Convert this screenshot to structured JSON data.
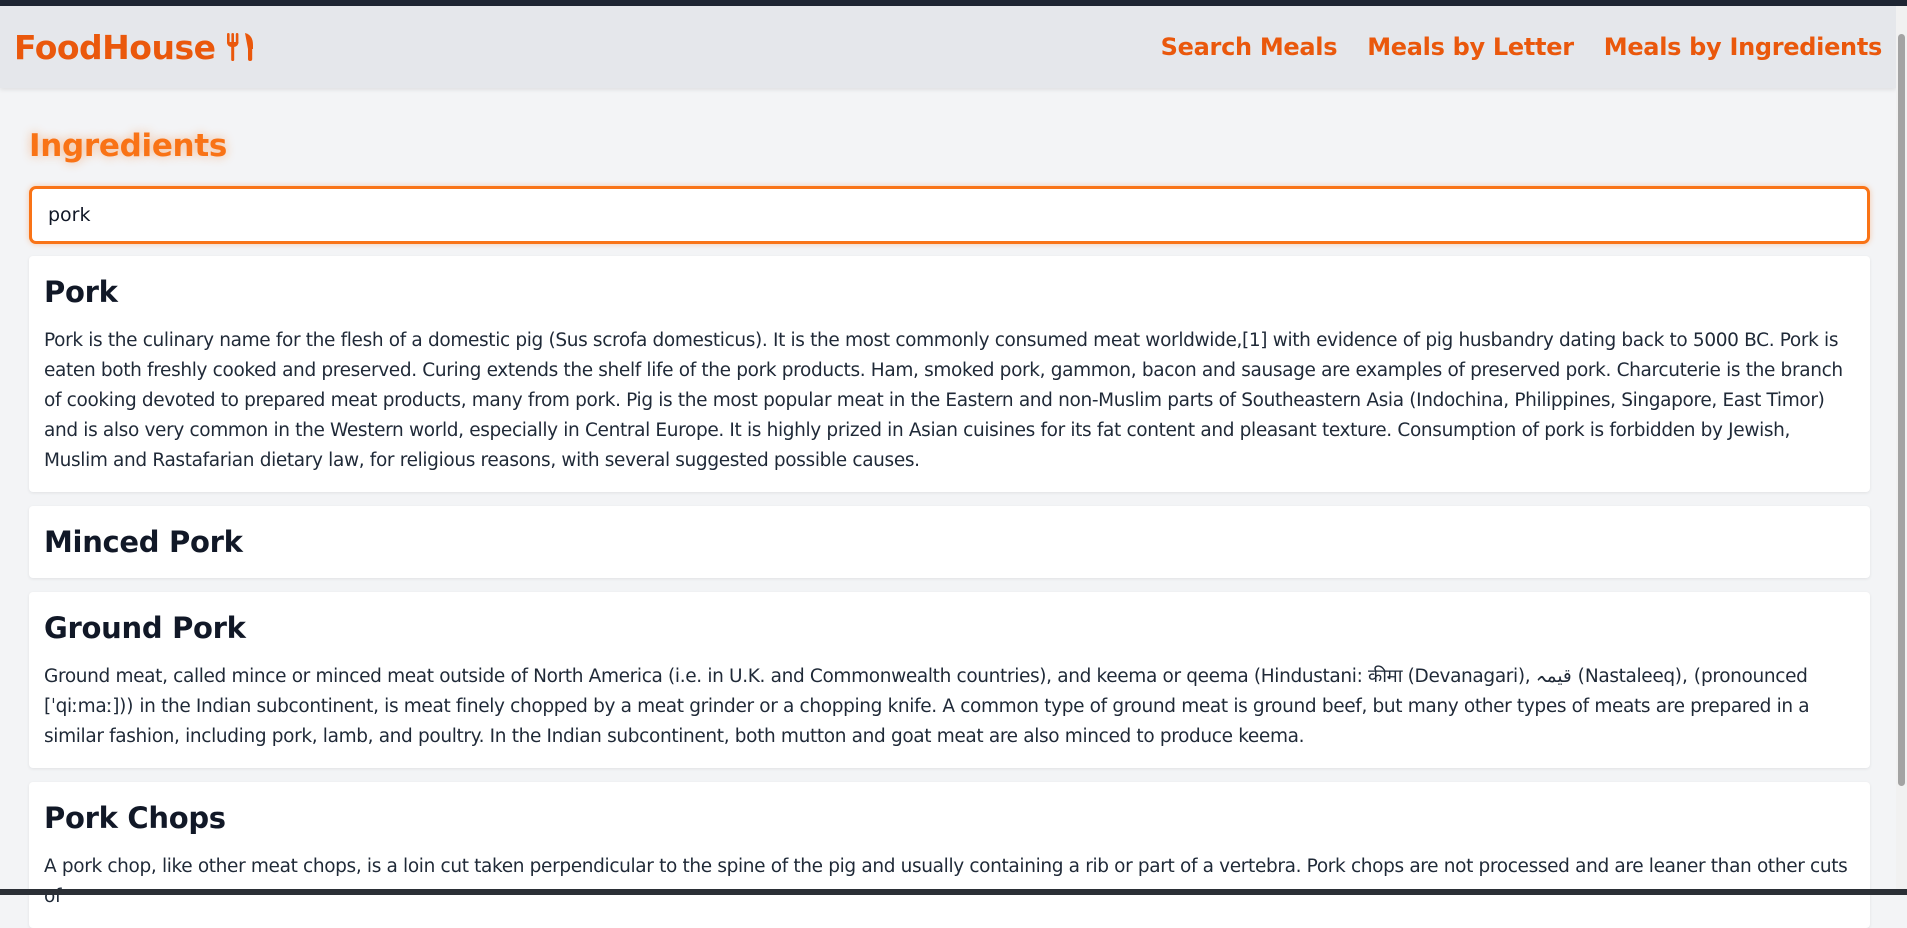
{
  "navbar": {
    "brand": "FoodHouse",
    "brand_icon": "fork-knife-icon",
    "links": [
      "Search Meals",
      "Meals by Letter",
      "Meals by Ingredients"
    ]
  },
  "page": {
    "title": "Ingredients"
  },
  "search": {
    "value": "pork",
    "placeholder": ""
  },
  "ingredients": [
    {
      "name": "Pork",
      "description": "Pork is the culinary name for the flesh of a domestic pig (Sus scrofa domesticus). It is the most commonly consumed meat worldwide,[1] with evidence of pig husbandry dating back to 5000 BC. Pork is eaten both freshly cooked and preserved. Curing extends the shelf life of the pork products. Ham, smoked pork, gammon, bacon and sausage are examples of preserved pork. Charcuterie is the branch of cooking devoted to prepared meat products, many from pork. Pig is the most popular meat in the Eastern and non-Muslim parts of Southeastern Asia (Indochina, Philippines, Singapore, East Timor) and is also very common in the Western world, especially in Central Europe. It is highly prized in Asian cuisines for its fat content and pleasant texture. Consumption of pork is forbidden by Jewish, Muslim and Rastafarian dietary law, for religious reasons, with several suggested possible causes."
    },
    {
      "name": "Minced Pork",
      "description": ""
    },
    {
      "name": "Ground Pork",
      "description": "Ground meat, called mince or minced meat outside of North America (i.e. in U.K. and Commonwealth countries), and keema or qeema (Hindustani: कीमा (Devanagari), قیمہ (Nastaleeq), (pronounced [ˈqiːmaː])) in the Indian subcontinent, is meat finely chopped by a meat grinder or a chopping knife. A common type of ground meat is ground beef, but many other types of meats are prepared in a similar fashion, including pork, lamb, and poultry. In the Indian subcontinent, both mutton and goat meat are also minced to produce keema."
    },
    {
      "name": "Pork Chops",
      "description": "A pork chop, like other meat chops, is a loin cut taken perpendicular to the spine of the pig and usually containing a rib or part of a vertebra. Pork chops are not processed and are leaner than other cuts of"
    }
  ],
  "colors": {
    "accent": "#f97316",
    "brand": "#ea580c",
    "navbar_bg": "#e5e7eb",
    "page_bg": "#f3f4f6"
  }
}
